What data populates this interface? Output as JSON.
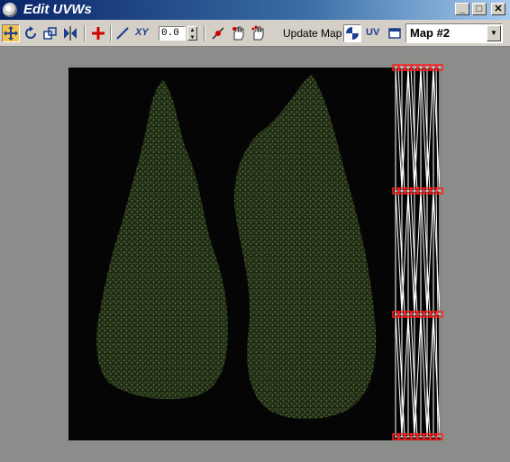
{
  "window": {
    "title": "Edit UVWs"
  },
  "title_buttons": {
    "minimize": "_",
    "maximize": "□",
    "close": "✕"
  },
  "toolbar": {
    "tools": [
      {
        "name": "move-tool",
        "icon": "move-arrows-icon",
        "active": true
      },
      {
        "name": "rotate-tool",
        "icon": "rotate-icon"
      },
      {
        "name": "scale-tool",
        "icon": "scale-icon"
      },
      {
        "name": "mirror-tool",
        "icon": "mirror-icon"
      },
      {
        "name": "pan-tool",
        "icon": "pan-cross-icon"
      },
      {
        "name": "weld-tool",
        "icon": "freeform-line-icon"
      }
    ],
    "coord_label": "XY",
    "spinner_value": "0.0",
    "update_map_label": "Update Map",
    "uv_label": "UV",
    "map_select_value": "Map #2"
  },
  "colors": {
    "title_start": "#0a246a",
    "title_end": "#a6caf0",
    "viewport_bg": "#8b8d8a",
    "selected_vertex": "#ff2020",
    "active_tool": "#f2c24a"
  }
}
